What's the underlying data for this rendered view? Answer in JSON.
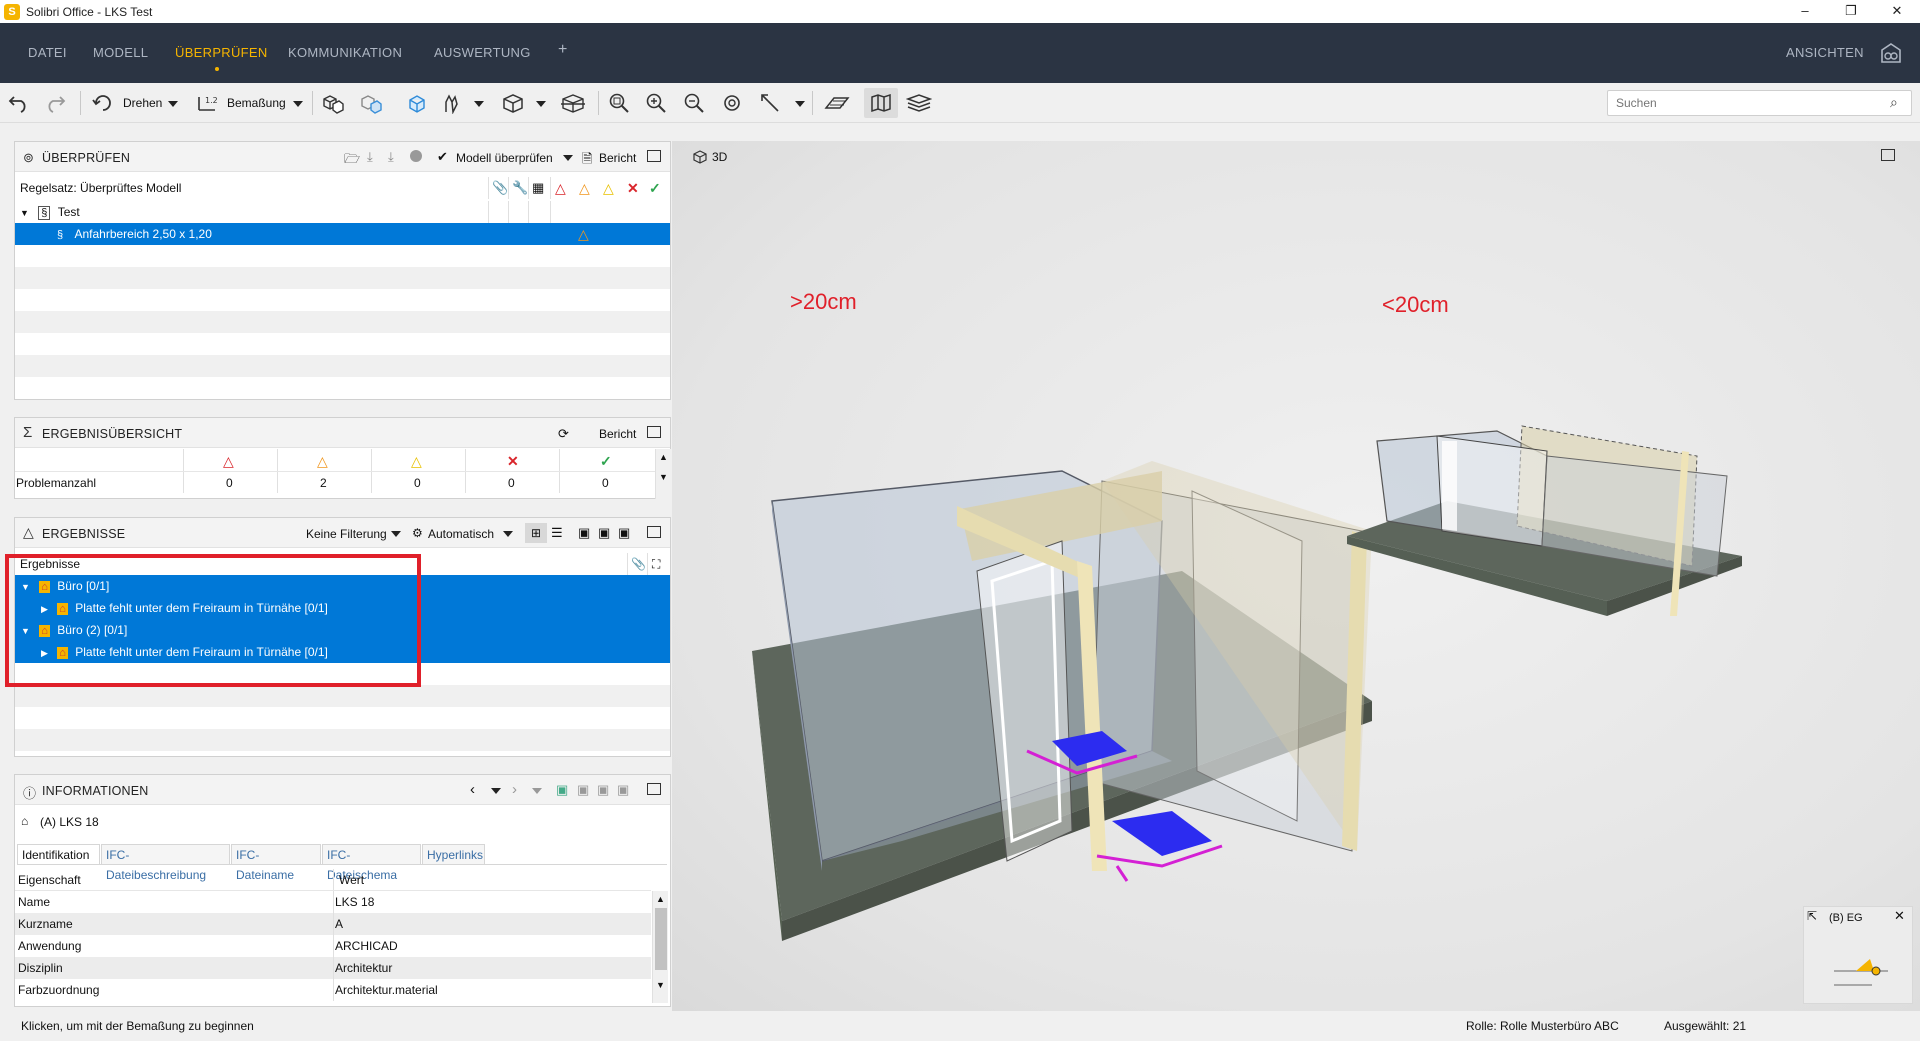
{
  "app": {
    "title": "Solibri Office - LKS Test",
    "logo_letter": "S"
  },
  "window": {
    "minimize": "–",
    "maximize": "❐",
    "close": "✕"
  },
  "menu": {
    "items": [
      "DATEI",
      "MODELL",
      "ÜBERPRÜFEN",
      "KOMMUNIKATION",
      "AUSWERTUNG"
    ],
    "active_index": 2,
    "add": "+",
    "right": "ANSICHTEN"
  },
  "toolbar": {
    "rotate_label": "Drehen",
    "measure_label": "Bemaßung",
    "search_placeholder": "Suchen"
  },
  "check_panel": {
    "title": "ÜBERPRÜFEN",
    "check_model_label": "Modell überprüfen",
    "report_label": "Bericht",
    "ruleset_label": "Regelsatz: Überprüftes Modell",
    "tree": [
      {
        "label": "Test",
        "level": 0
      },
      {
        "label": "Anfahrbereich 2,50 x 1,20",
        "level": 1
      }
    ]
  },
  "summary_panel": {
    "title": "ERGEBNISÜBERSICHT",
    "report_label": "Bericht",
    "row_label": "Problemanzahl",
    "counts": [
      "0",
      "2",
      "0",
      "0",
      "0"
    ]
  },
  "results_panel": {
    "title": "ERGEBNISSE",
    "filter_label": "Keine Filterung",
    "auto_label": "Automatisch",
    "header": "Ergebnisse",
    "rows": [
      {
        "label": "Büro [0/1]",
        "level": 0
      },
      {
        "label": "Platte fehlt unter dem Freiraum in Türnähe [0/1]",
        "level": 1
      },
      {
        "label": "Büro (2) [0/1]",
        "level": 0
      },
      {
        "label": "Platte fehlt unter dem Freiraum in Türnähe [0/1]",
        "level": 1
      }
    ]
  },
  "info_panel": {
    "title": "INFORMATIONEN",
    "selected": "(A) LKS 18",
    "tabs": [
      "Identifikation",
      "IFC-Dateibeschreibung",
      "IFC-Dateiname",
      "IFC-Dateischema",
      "Hyperlinks"
    ],
    "col_property": "Eigenschaft",
    "col_value": "Wert",
    "rows": [
      {
        "key": "Name",
        "value": "LKS 18"
      },
      {
        "key": "Kurzname",
        "value": "A"
      },
      {
        "key": "Anwendung",
        "value": "ARCHICAD"
      },
      {
        "key": "Disziplin",
        "value": "Architektur"
      },
      {
        "key": "Farbzuordnung",
        "value": "Architektur.material"
      }
    ]
  },
  "viewport": {
    "label": "3D",
    "annotation_left": ">20cm",
    "annotation_right": "<20cm",
    "minimap_label": "(B) EG"
  },
  "status": {
    "hint": "Klicken, um mit der Bemaßung zu beginnen",
    "role": "Rolle: Rolle Musterbüro ABC",
    "selected": "Ausgewählt: 21"
  },
  "colors": {
    "menubar": "#2b3443",
    "accent": "#f5b400",
    "selection": "#0078d7",
    "highlight_box": "#e0202a"
  }
}
